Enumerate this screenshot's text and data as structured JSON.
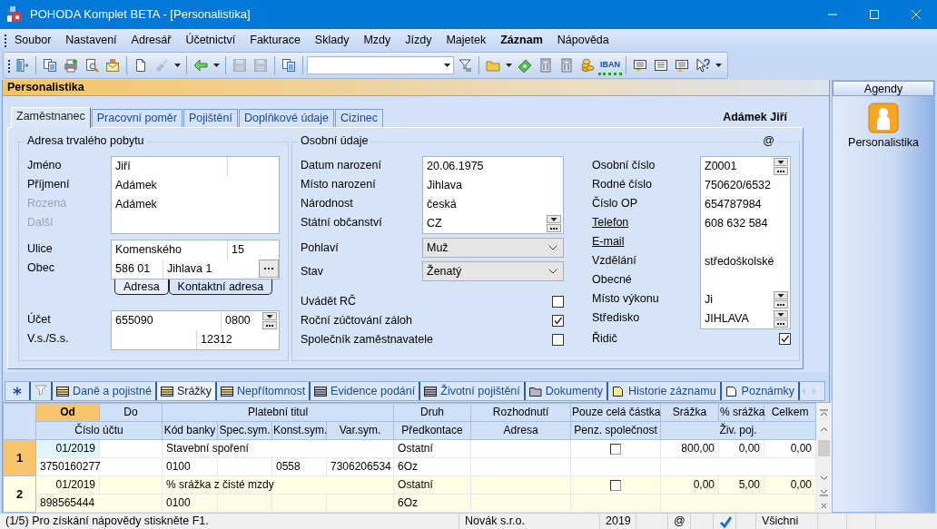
{
  "window": {
    "title": "POHODA Komplet BETA - [Personalistika]"
  },
  "menu": [
    {
      "label": "Soubor",
      "selected": false
    },
    {
      "label": "Nastavení",
      "selected": false
    },
    {
      "label": "Adresář",
      "selected": false
    },
    {
      "label": "Účetnictví",
      "selected": false
    },
    {
      "label": "Fakturace",
      "selected": false
    },
    {
      "label": "Sklady",
      "selected": false
    },
    {
      "label": "Mzdy",
      "selected": false
    },
    {
      "label": "Jízdy",
      "selected": false
    },
    {
      "label": "Majetek",
      "selected": false
    },
    {
      "label": "Záznam",
      "selected": true
    },
    {
      "label": "Nápověda",
      "selected": false
    }
  ],
  "toolbar": {
    "iban_label": "IBAN"
  },
  "panel": {
    "title": "Personalistika",
    "record_name": "Adámek Jiří"
  },
  "tabs": [
    {
      "label": "Zaměstnanec",
      "selected": true
    },
    {
      "label": "Pracovní poměr",
      "selected": false
    },
    {
      "label": "Pojištění",
      "selected": false
    },
    {
      "label": "Doplňkové údaje",
      "selected": false
    },
    {
      "label": "Cizinec",
      "selected": false
    }
  ],
  "address": {
    "title": "Adresa trvalého pobytu",
    "names": [
      {
        "label": "Jméno",
        "value": "Jiří",
        "disabled": false
      },
      {
        "label": "Příjmení",
        "value": "Adámek",
        "disabled": false
      },
      {
        "label": "Rozená",
        "value": "Adámek",
        "disabled": true
      },
      {
        "label": "Další",
        "disabled": true
      }
    ],
    "street": {
      "label": "Ulice",
      "value": "Komenského",
      "number": "15"
    },
    "city": {
      "label": "Obec",
      "zip": "586 01",
      "value": "Jihlava 1"
    },
    "address_tabs": [
      {
        "label": "Adresa",
        "selected": true
      },
      {
        "label": "Kontaktní adresa",
        "selected": false
      }
    ],
    "account": {
      "label": "Účet",
      "value": "655090",
      "bank_code": "0800"
    },
    "symbols": {
      "label": "V.s./S.s.",
      "specific": "12312"
    }
  },
  "personal": {
    "title": "Osobní údaje",
    "corner": "@",
    "fields": [
      {
        "label": "Datum narození",
        "value": "20.06.1975",
        "kind": "text"
      },
      {
        "label": "Místo narození",
        "value": "Jihlava",
        "kind": "text"
      },
      {
        "label": "Národnost",
        "value": "česká",
        "kind": "text"
      },
      {
        "label": "Státní občanství",
        "value": "CZ",
        "kind": "picker"
      }
    ],
    "selects": [
      {
        "label": "Pohlaví",
        "value": "Muž"
      },
      {
        "label": "Stav",
        "value": "Ženatý"
      }
    ],
    "checks": [
      {
        "label": "Uvádět RČ",
        "checked": false
      },
      {
        "label": "Roční zúčtování záloh",
        "checked": true
      },
      {
        "label": "Společník zaměstnavatele",
        "checked": false
      }
    ]
  },
  "identity": {
    "fields": [
      {
        "label": "Osobní číslo",
        "value": "Z0001",
        "kind": "picker",
        "link": false
      },
      {
        "label": "Rodné číslo",
        "value": "750620/6532",
        "kind": "text",
        "link": false
      },
      {
        "label": "Číslo OP",
        "value": "654787984",
        "kind": "text",
        "link": false
      },
      {
        "label": "Telefon",
        "value": "608 632 584",
        "kind": "text",
        "link": true
      },
      {
        "label": "E-mail",
        "kind": "text",
        "link": true
      },
      {
        "label": "Vzdělání",
        "value": "středoškolské",
        "kind": "text",
        "link": false
      },
      {
        "label": "Obecné",
        "kind": "text",
        "link": false
      },
      {
        "label": "Místo výkonu",
        "value": "Ji",
        "kind": "picker",
        "link": false
      },
      {
        "label": "Středisko",
        "value": "JIHLAVA",
        "kind": "picker",
        "link": false
      }
    ],
    "checks": [
      {
        "label": "Řidič",
        "checked": true
      }
    ]
  },
  "agendas": {
    "title": "Agendy",
    "items": [
      {
        "label": "Personalistika"
      }
    ]
  },
  "bottom_tabs": [
    {
      "label": "Daně a pojistné",
      "kind": "table",
      "selected": false
    },
    {
      "label": "Srážky",
      "kind": "table",
      "selected": true
    },
    {
      "label": "Nepřítomnost",
      "kind": "table",
      "selected": false
    },
    {
      "label": "Evidence podání",
      "kind": "register",
      "selected": false
    },
    {
      "label": "Životní pojištění",
      "kind": "register",
      "selected": false
    },
    {
      "label": "Dokumenty",
      "kind": "folder",
      "selected": false
    },
    {
      "label": "Historie záznamu",
      "kind": "history",
      "selected": false
    },
    {
      "label": "Poznámky",
      "kind": "note",
      "selected": false
    }
  ],
  "table": {
    "header_rows": [
      [
        {
          "label": "Od",
          "sorted": true
        },
        {
          "label": "Do",
          "sorted": false
        },
        {
          "label": "Platební titul",
          "sorted": false
        },
        {
          "label": "Druh",
          "sorted": false
        },
        {
          "label": "Rozhodnutí",
          "sorted": false
        },
        {
          "label": "Pouze celá částka",
          "sorted": false
        },
        {
          "label": "Srážka",
          "sorted": false
        },
        {
          "label": "% srážka",
          "sorted": false
        },
        {
          "label": "Celkem",
          "sorted": false
        }
      ],
      [
        {
          "label": "Číslo účtu",
          "sorted": false
        },
        {
          "label": "Kód banky",
          "sorted": false
        },
        {
          "label": "Spec.sym.",
          "sorted": false
        },
        {
          "label": "Konst.sym.",
          "sorted": false
        },
        {
          "label": "Var.sym.",
          "sorted": false
        },
        {
          "label": "Předkontace",
          "sorted": false
        },
        {
          "label": "Adresa",
          "sorted": false
        },
        {
          "label": "Penz. společnost",
          "sorted": false
        },
        {
          "label": "Živ. poj.",
          "sorted": false
        }
      ]
    ],
    "rows": [
      {
        "number": "1",
        "selected": true,
        "from": "01/2019",
        "title": "Stavební spoření",
        "type": "Ostatní",
        "whole_amount": false,
        "deduction": "800,00",
        "percent": "0,00",
        "total": "0,00",
        "account": "3750160277",
        "bank_code": "0100",
        "const_sym": "0558",
        "var_sym": "7306206534",
        "precontation": "6Oz"
      },
      {
        "number": "2",
        "selected": false,
        "from": "01/2019",
        "title": "% srážka z čisté mzdy",
        "type": "Ostatní",
        "whole_amount": false,
        "deduction": "0,00",
        "percent": "5,00",
        "total": "0,00",
        "account": "898565444",
        "bank_code": "0100",
        "precontation": "6Oz"
      }
    ]
  },
  "status_bar": {
    "help": "(1/5) Pro získání nápovědy stiskněte F1.",
    "company": "Novák s.r.o.",
    "year": "2019",
    "mail": "@",
    "user": "Všichni"
  }
}
